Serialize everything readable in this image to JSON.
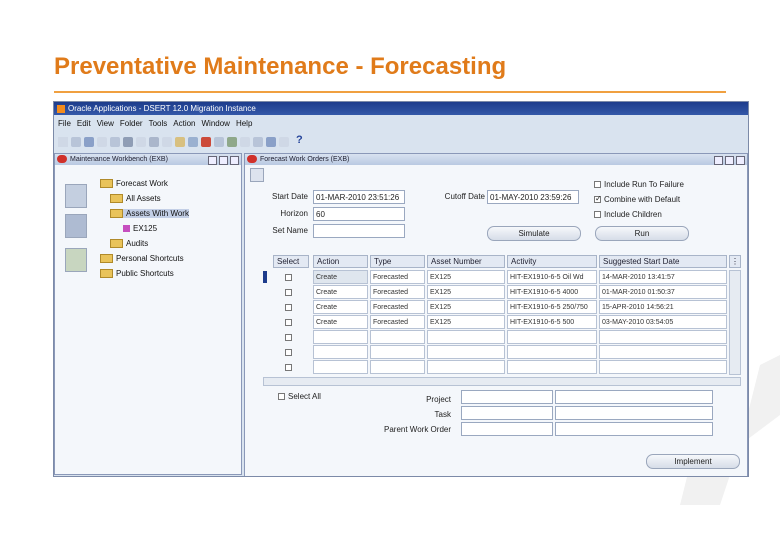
{
  "slide": {
    "title": "Preventative Maintenance - Forecasting"
  },
  "app": {
    "title": "Oracle Applications - DSERT 12.0 Migration Instance",
    "menu": [
      "File",
      "Edit",
      "View",
      "Folder",
      "Tools",
      "Action",
      "Window",
      "Help"
    ],
    "toolbar_help": "?"
  },
  "left_window": {
    "title": "Maintenance Workbench (EXB)",
    "tree": [
      {
        "label": "Forecast Work"
      },
      {
        "label": "All Assets"
      },
      {
        "label": "Assets With Work"
      },
      {
        "label": "EX125"
      },
      {
        "label": "Audits"
      },
      {
        "label": "Personal Shortcuts"
      },
      {
        "label": "Public Shortcuts"
      }
    ]
  },
  "right_window": {
    "title": "Forecast Work Orders (EXB)",
    "start_date_label": "Start Date",
    "start_date": "01-MAR-2010 23:51:26",
    "cutoff_date_label": "Cutoff Date",
    "cutoff_date": "01-MAY-2010 23:59:26",
    "horizon_label": "Horizon",
    "horizon": "60",
    "set_name_label": "Set Name",
    "set_name": "",
    "include_label": "Include Run To Failure",
    "combine_label": "Combine with Default",
    "include_children_label": "Include Children",
    "simulate_button": "Simulate",
    "run_button": "Run",
    "columns": [
      "Select",
      "Action",
      "Type",
      "Asset Number",
      "Activity",
      "Suggested Start Date"
    ],
    "rows": [
      [
        "Create",
        "Forecasted",
        "EX125",
        "HIT-EX1910-6-5 Oil Wd",
        "14-MAR-2010 13:41:57"
      ],
      [
        "Create",
        "Forecasted",
        "EX125",
        "HIT-EX1910-6-5 4000",
        "01-MAR-2010 01:50:37"
      ],
      [
        "Create",
        "Forecasted",
        "EX125",
        "HIT-EX1910-6-5 250/750",
        "15-APR-2010 14:56:21"
      ],
      [
        "Create",
        "Forecasted",
        "EX125",
        "HIT-EX1910-6-5 500",
        "03-MAY-2010 03:54:05"
      ]
    ],
    "select_all_label": "Select All",
    "project_label": "Project",
    "task_label": "Task",
    "parent_wo_label": "Parent Work Order",
    "implement_button": "Implement"
  },
  "colors": {
    "title": "#e07b1a",
    "rule": "#f0a040",
    "titlebar": "#1d3c8c"
  }
}
